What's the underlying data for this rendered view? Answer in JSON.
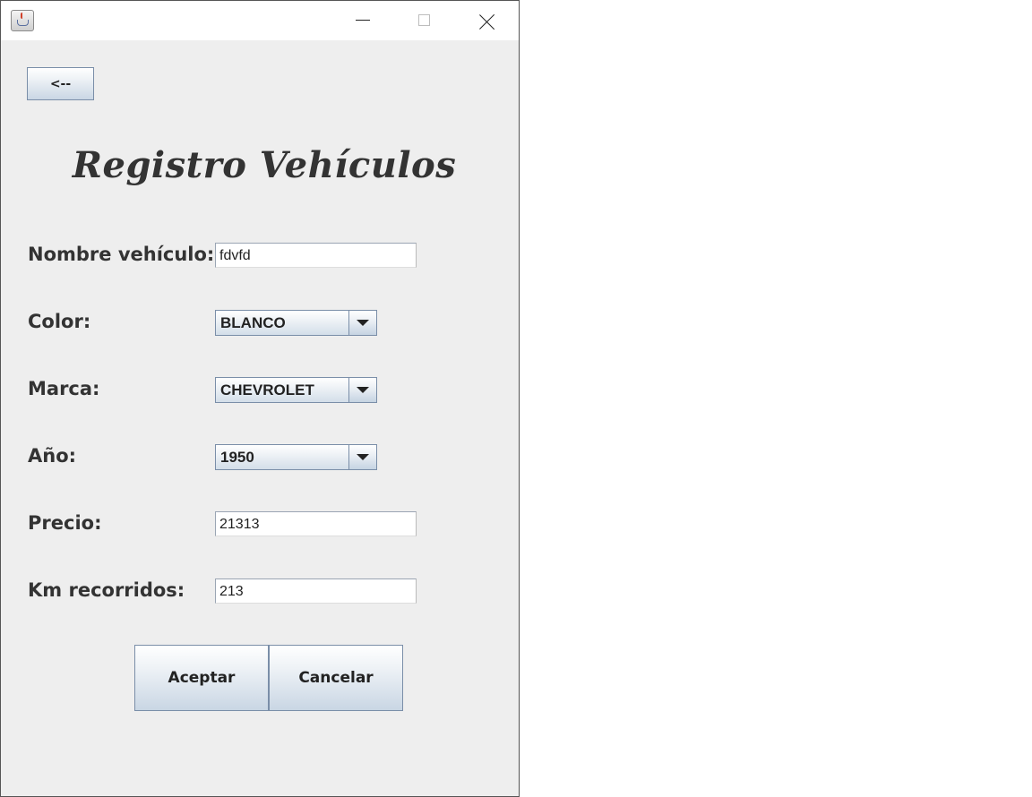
{
  "window": {
    "title": ""
  },
  "back_button": {
    "label": "<--"
  },
  "form": {
    "title": "Registro Vehículos",
    "fields": [
      {
        "label": "Nombre vehículo:",
        "value": "fdvfd"
      },
      {
        "label": "Color:",
        "value": "BLANCO"
      },
      {
        "label": "Marca:",
        "value": "CHEVROLET"
      },
      {
        "label": "Año:",
        "value": "1950"
      },
      {
        "label": "Precio:",
        "value": "21313"
      },
      {
        "label": "Km recorridos:",
        "value": "213"
      }
    ]
  },
  "actions": {
    "accept": "Aceptar",
    "cancel": "Cancelar"
  }
}
